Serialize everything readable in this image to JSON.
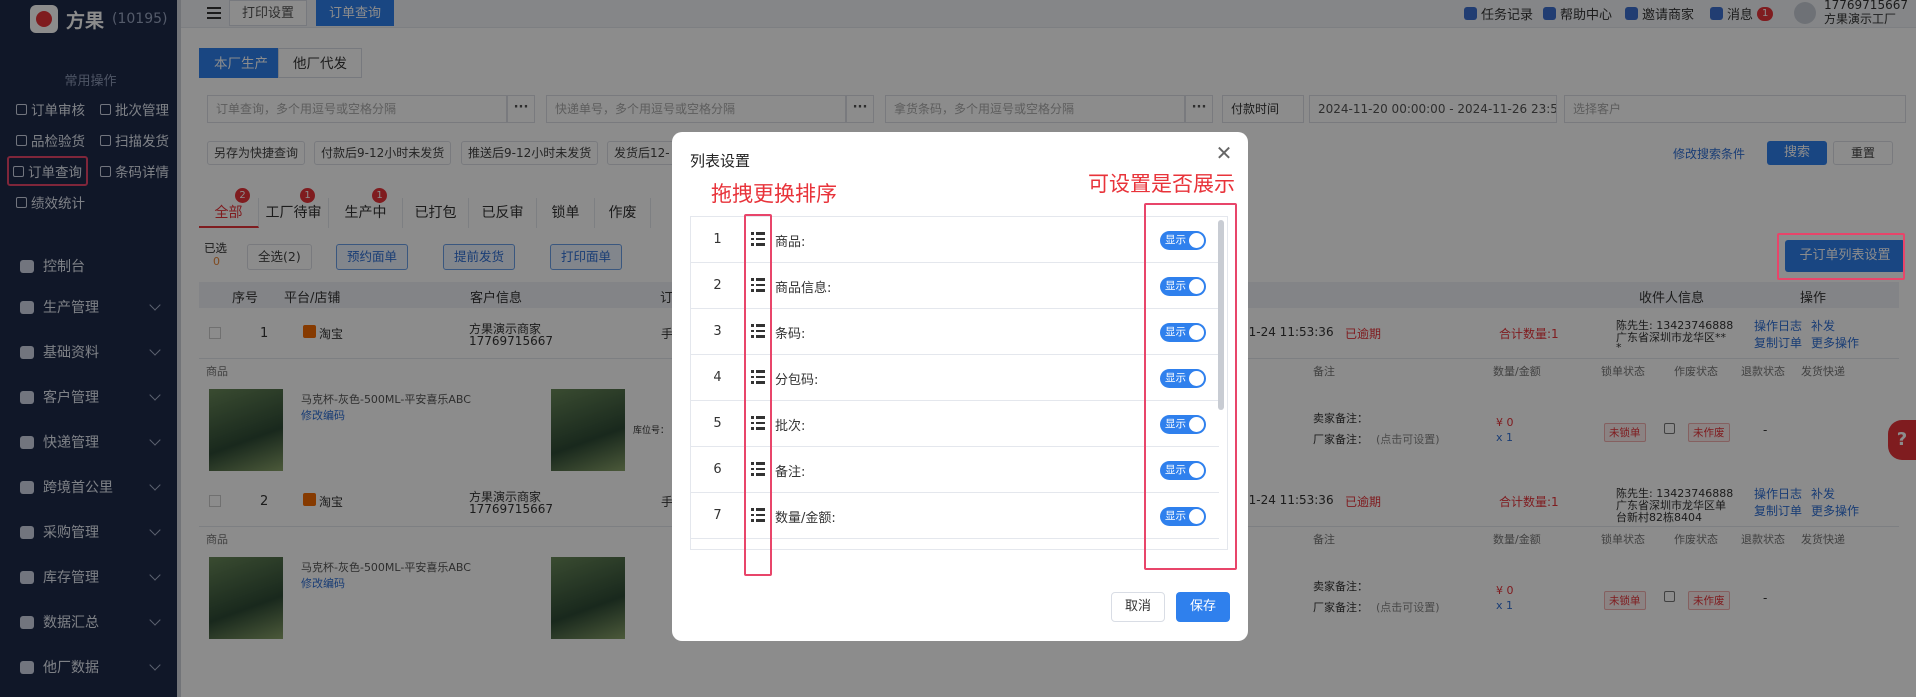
{
  "app": {
    "name": "方果",
    "count": "(10195)"
  },
  "sidebar": {
    "quick_title": "常用操作",
    "quick": [
      {
        "label": "订单审核"
      },
      {
        "label": "批次管理"
      },
      {
        "label": "品检验货"
      },
      {
        "label": "扫描发货"
      },
      {
        "label": "订单查询"
      },
      {
        "label": "条码详情"
      },
      {
        "label": "绩效统计"
      }
    ],
    "menu": [
      {
        "label": "控制台"
      },
      {
        "label": "生产管理"
      },
      {
        "label": "基础资料"
      },
      {
        "label": "客户管理"
      },
      {
        "label": "快递管理"
      },
      {
        "label": "跨境首公里"
      },
      {
        "label": "采购管理"
      },
      {
        "label": "库存管理"
      },
      {
        "label": "数据汇总"
      },
      {
        "label": "他厂数据"
      }
    ]
  },
  "topbar": {
    "tabs": [
      "打印设置",
      "订单查询"
    ],
    "links": [
      "任务记录",
      "帮助中心",
      "邀请商家",
      "消息"
    ],
    "msg_badge": "1",
    "user_phone": "17769715667",
    "user_name": "方果演示工厂"
  },
  "subtabs": [
    "本厂生产",
    "他厂代发"
  ],
  "filters": {
    "order_ph": "订单查询，多个用逗号或空格分隔",
    "express_ph": "快递单号，多个用逗号或空格分隔",
    "barcode_ph": "拿货条码，多个用逗号或空格分隔",
    "time_type": "付款时间",
    "date_range": "2024-11-20 00:00:00 - 2024-11-26 23:59:59",
    "customer_ph": "选择客户"
  },
  "chips": [
    "另存为快捷查询",
    "付款后9-12小时未发货",
    "推送后9-12小时未发货",
    "发货后12-"
  ],
  "search_actions": {
    "modify": "修改搜索条件",
    "search": "搜索",
    "reset": "重置"
  },
  "order_tabs": [
    {
      "label": "全部",
      "badge": "2"
    },
    {
      "label": "工厂待审",
      "badge": "1"
    },
    {
      "label": "生产中",
      "badge": "1"
    },
    {
      "label": "已打包",
      "badge": ""
    },
    {
      "label": "已反审",
      "badge": ""
    },
    {
      "label": "锁单",
      "badge": ""
    },
    {
      "label": "作废",
      "badge": ""
    }
  ],
  "selection": {
    "selected_label": "已选",
    "selected_count": "0",
    "select_all": "全选(2)"
  },
  "actions": [
    "预约面单",
    "提前发货",
    "打印面单"
  ],
  "sub_list_btn": "子订单列表设置",
  "table": {
    "headers": [
      "序号",
      "平台/店铺",
      "客户信息",
      "订",
      "收件人信息",
      "操作"
    ],
    "sub_headers": [
      "商品",
      "备注",
      "数量/金额",
      "锁单状态",
      "作废状态",
      "退款状态",
      "发货快递"
    ],
    "rows": [
      {
        "no": "1",
        "shop": "淘宝",
        "customer": "方果演示商家",
        "phone": "17769715667",
        "order_prefix": "手",
        "time": "11-24 11:53:36",
        "overdue": "已逾期",
        "total": "合计数量:1",
        "recipient1": "陈先生: 13423746888",
        "recipient2": "广东省深圳市龙华区**",
        "recipient3": "*",
        "ops": [
          "操作日志",
          "补发",
          "复制订单",
          "更多操作"
        ],
        "product": "马克杯-灰色-500ML-平安喜乐ABC",
        "edit": "修改编码",
        "pos": "库位号：",
        "seller_note": "卖家备注：",
        "factory_note": "厂家备注：",
        "note_hint": "(点击可设置)",
        "amount": "¥ 0",
        "qty": "x 1",
        "lock": "未锁单",
        "void": "未作废",
        "refund": "-"
      },
      {
        "no": "2",
        "shop": "淘宝",
        "customer": "方果演示商家",
        "phone": "17769715667",
        "order_prefix": "手",
        "time": "11-24 11:53:36",
        "overdue": "已逾期",
        "total": "合计数量:1",
        "recipient1": "陈先生: 13423746888",
        "recipient2": "广东省深圳市龙华区单",
        "recipient3": "台新村82栋8404",
        "ops": [
          "操作日志",
          "补发",
          "复制订单",
          "更多操作"
        ],
        "product": "马克杯-灰色-500ML-平安喜乐ABC",
        "edit": "修改编码",
        "pos": "",
        "seller_note": "卖家备注：",
        "factory_note": "厂家备注：",
        "note_hint": "(点击可设置)",
        "amount": "¥ 0",
        "qty": "x 1",
        "lock": "未锁单",
        "void": "未作废",
        "refund": "-"
      }
    ]
  },
  "modal": {
    "title": "列表设置",
    "toggle_label": "显示",
    "cancel": "取消",
    "save": "保存",
    "items": [
      {
        "no": "1",
        "name": "商品:"
      },
      {
        "no": "2",
        "name": "商品信息:"
      },
      {
        "no": "3",
        "name": "条码:"
      },
      {
        "no": "4",
        "name": "分包码:"
      },
      {
        "no": "5",
        "name": "批次:"
      },
      {
        "no": "6",
        "name": "备注:"
      },
      {
        "no": "7",
        "name": "数量/金额:"
      }
    ]
  },
  "annotations": {
    "drag": "拖拽更换排序",
    "show": "可设置是否展示"
  },
  "help": "?"
}
